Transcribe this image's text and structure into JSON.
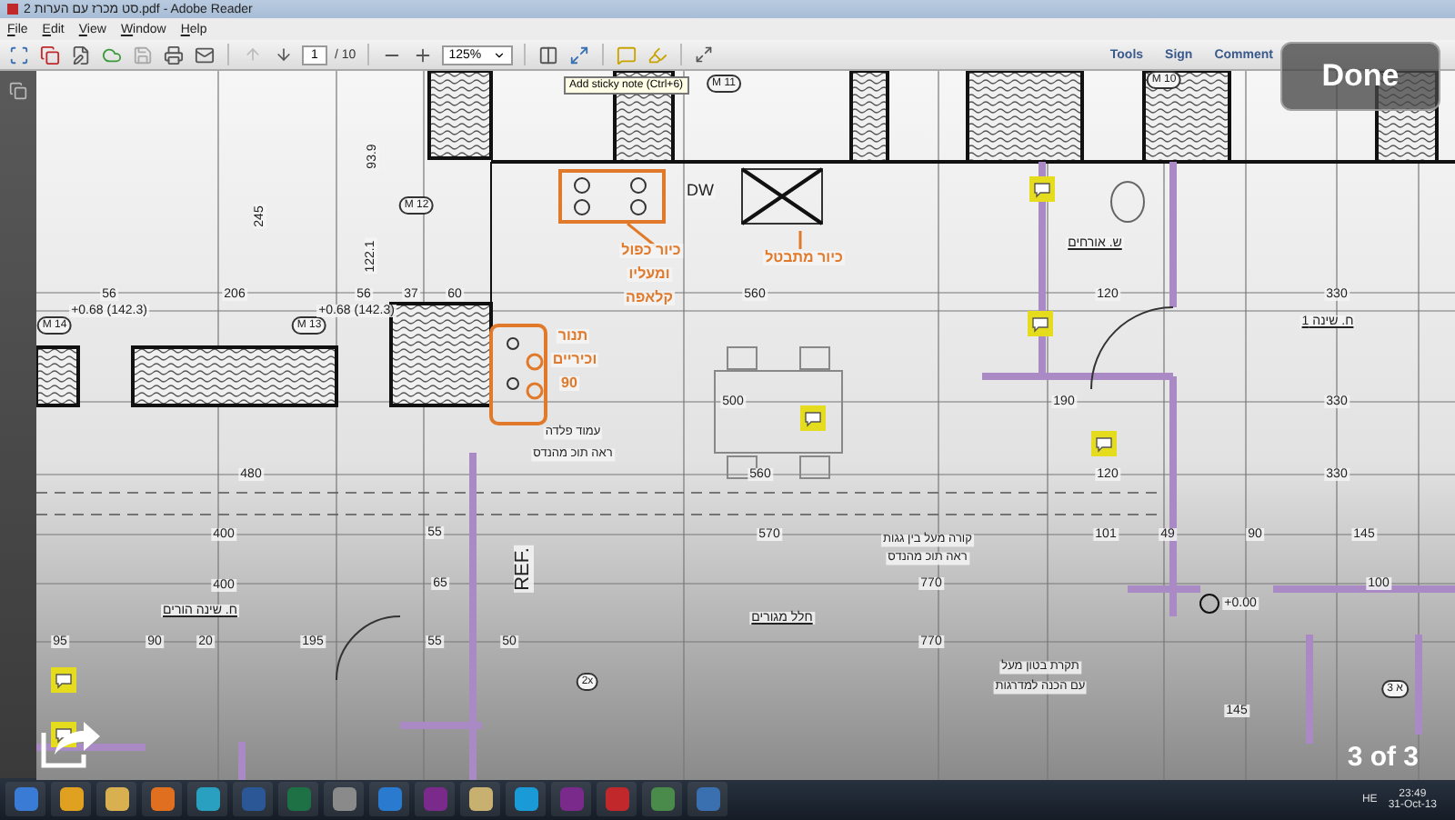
{
  "title_bar": {
    "title": "סט מכרז עם הערות 2.pdf - Adobe Reader"
  },
  "menu": [
    "File",
    "Edit",
    "View",
    "Window",
    "Help"
  ],
  "toolbar": {
    "page": "1",
    "page_count": "/ 10",
    "zoom": "125%",
    "tooltip": "Add sticky note (Ctrl+6)",
    "panels": [
      "Tools",
      "Sign",
      "Comment"
    ]
  },
  "plan": {
    "labels": [
      {
        "kind": "tag",
        "text": "M 11"
      },
      {
        "kind": "tag",
        "text": "M 10"
      },
      {
        "kind": "tag",
        "text": "M 12"
      },
      {
        "kind": "tag",
        "text": "M 14"
      },
      {
        "kind": "tag",
        "text": "M 13"
      },
      {
        "kind": "vertical_dimension",
        "text": "93.9"
      },
      {
        "kind": "vertical_dimension",
        "text": "245"
      },
      {
        "kind": "vertical_dimension",
        "text": "122.1"
      },
      {
        "kind": "dimension",
        "text": "56"
      },
      {
        "kind": "dimension",
        "text": "206"
      },
      {
        "kind": "dimension",
        "text": "56"
      },
      {
        "kind": "dimension",
        "text": "37"
      },
      {
        "kind": "dimension",
        "text": "60"
      },
      {
        "kind": "dimension",
        "text": "+0.68 (142.3)"
      },
      {
        "kind": "dimension",
        "text": "+0.68 (142.3)"
      },
      {
        "kind": "fixture",
        "text": "DW"
      },
      {
        "kind": "callout",
        "text": "כיור כפול"
      },
      {
        "kind": "callout",
        "text": "ומעליו"
      },
      {
        "kind": "callout",
        "text": "קלאפה"
      },
      {
        "kind": "callout",
        "text": "כיור מתבטל"
      },
      {
        "kind": "callout",
        "text": "תנור"
      },
      {
        "kind": "callout",
        "text": "וכיריים"
      },
      {
        "kind": "callout",
        "text": "90"
      },
      {
        "kind": "note",
        "text": "עמוד פלדה"
      },
      {
        "kind": "note",
        "text": "ראה תוכ מהנדס"
      },
      {
        "kind": "dimension",
        "text": "560"
      },
      {
        "kind": "room",
        "text": "ש. אורחים"
      },
      {
        "kind": "dimension",
        "text": "120"
      },
      {
        "kind": "dimension",
        "text": "330"
      },
      {
        "kind": "room",
        "text": "ח. שינה 1"
      },
      {
        "kind": "dimension",
        "text": "500"
      },
      {
        "kind": "dimension",
        "text": "190"
      },
      {
        "kind": "dimension",
        "text": "330"
      },
      {
        "kind": "dimension",
        "text": "480"
      },
      {
        "kind": "dimension",
        "text": "560"
      },
      {
        "kind": "dimension",
        "text": "120"
      },
      {
        "kind": "dimension",
        "text": "330"
      },
      {
        "kind": "dimension",
        "text": "400"
      },
      {
        "kind": "dimension",
        "text": "55"
      },
      {
        "kind": "dimension",
        "text": "570"
      },
      {
        "kind": "note",
        "text": "קורה מעל בין גגות"
      },
      {
        "kind": "note",
        "text": "ראה תוכ מהנדס"
      },
      {
        "kind": "dimension",
        "text": "101"
      },
      {
        "kind": "dimension",
        "text": "49"
      },
      {
        "kind": "dimension",
        "text": "90"
      },
      {
        "kind": "dimension",
        "text": "145"
      },
      {
        "kind": "dimension",
        "text": "400"
      },
      {
        "kind": "dimension",
        "text": "65"
      },
      {
        "kind": "vertical_label",
        "text": "REF."
      },
      {
        "kind": "dimension",
        "text": "770"
      },
      {
        "kind": "room",
        "text": "ח. שינה הורים"
      },
      {
        "kind": "room",
        "text": "חלל מגורים"
      },
      {
        "kind": "dimension",
        "text": "+0.00"
      },
      {
        "kind": "dimension",
        "text": "100"
      },
      {
        "kind": "dimension",
        "text": "95"
      },
      {
        "kind": "dimension",
        "text": "90"
      },
      {
        "kind": "dimension",
        "text": "20"
      },
      {
        "kind": "dimension",
        "text": "195"
      },
      {
        "kind": "dimension",
        "text": "55"
      },
      {
        "kind": "dimension",
        "text": "50"
      },
      {
        "kind": "dimension",
        "text": "770"
      },
      {
        "kind": "note",
        "text": "תקרת בטון מעל"
      },
      {
        "kind": "note",
        "text": "עם הכנה למדרגות"
      },
      {
        "kind": "tag",
        "text": "2x"
      },
      {
        "kind": "dimension",
        "text": "145"
      },
      {
        "kind": "tag",
        "text": "3 א"
      }
    ]
  },
  "viewer": {
    "done": "Done",
    "counter": "3 of 3"
  },
  "taskbar": {
    "language": "HE",
    "time": "23:49",
    "date": "31-Oct-13"
  }
}
